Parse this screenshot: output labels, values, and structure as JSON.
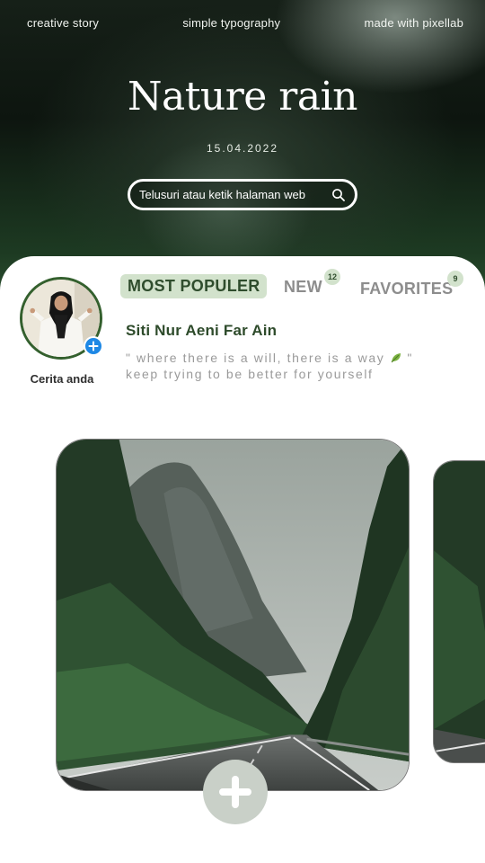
{
  "topnav": {
    "left": "creative story",
    "center": "simple typography",
    "right": "made with pixellab"
  },
  "hero": {
    "title": "Nature rain",
    "date": "15.04.2022"
  },
  "search": {
    "placeholder": "Telusuri atau ketik halaman web",
    "icon": "search-icon"
  },
  "story": {
    "label": "Cerita anda",
    "add_icon": "plus-icon"
  },
  "tabs": [
    {
      "label": "MOST POPULER",
      "active": true
    },
    {
      "label": "NEW",
      "badge": "12"
    },
    {
      "label": "FAVORITES",
      "badge": "9"
    }
  ],
  "profile": {
    "name": "Siti Nur Aeni Far Ain",
    "quote_line1": "\" where there is a will, there is a way",
    "quote_line1_end": " \"",
    "quote_line2": "keep trying to be better for yourself"
  },
  "colors": {
    "accent_green": "#2e4b2b",
    "tab_active_bg": "#d2e2cc",
    "add_blue": "#1e88e5",
    "plus_button_bg": "#c9d0c8"
  }
}
